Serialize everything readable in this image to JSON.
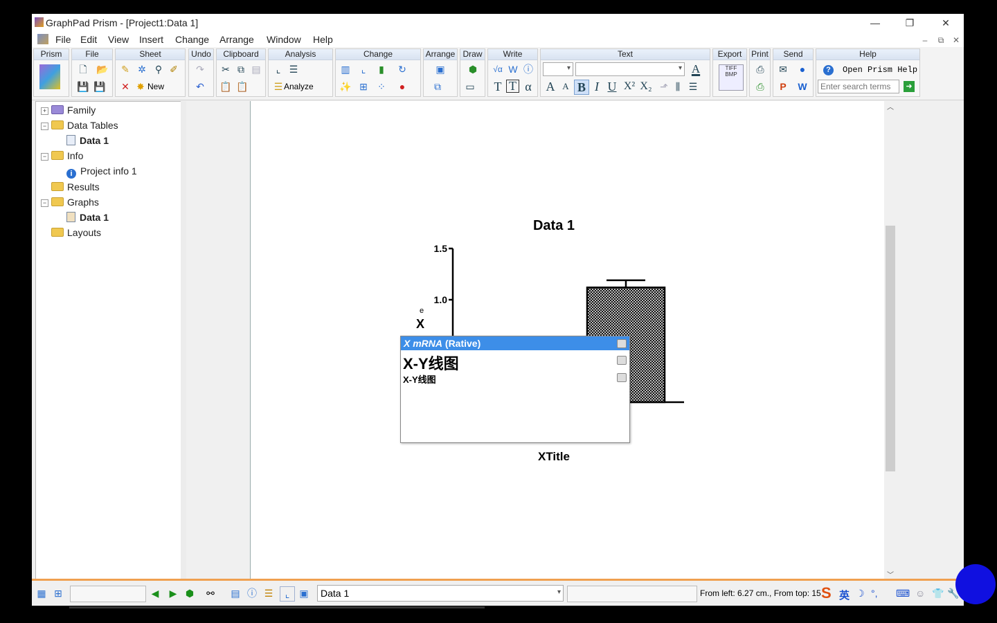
{
  "window": {
    "title": "GraphPad Prism - [Project1:Data 1]",
    "controls": {
      "minimize": "—",
      "restore": "❐",
      "close": "✕"
    },
    "mdi_controls": {
      "minimize": "–",
      "restore": "⧉",
      "close": "✕"
    }
  },
  "menu": [
    "File",
    "Edit",
    "View",
    "Insert",
    "Change",
    "Arrange",
    "Window",
    "Help"
  ],
  "toolbar": {
    "groups": [
      "Prism",
      "File",
      "Sheet",
      "Undo",
      "Clipboard",
      "Analysis",
      "Change",
      "Arrange",
      "Draw",
      "Write",
      "Text",
      "Export",
      "Print",
      "Send",
      "Help"
    ],
    "new_label": "New",
    "analyze_label": "Analyze",
    "help_label": "Open Prism Help",
    "search_placeholder": "Enter search terms",
    "text_glyphs": {
      "t1": "T",
      "t2": "T",
      "alpha": "α",
      "a_up": "A",
      "a_down": "A",
      "bold": "B",
      "italic": "I",
      "underline": "U",
      "sup": "X²",
      "sub": "X₂"
    },
    "export_label": "TIFF BMP"
  },
  "tree": {
    "family": "Family",
    "data_tables": "Data Tables",
    "data1_table": "Data 1",
    "info": "Info",
    "project_info": "Project info 1",
    "results": "Results",
    "graphs": "Graphs",
    "data1_graph": "Data 1",
    "layouts": "Layouts"
  },
  "chart_data": {
    "type": "bar",
    "title": "Data 1",
    "xlabel": "XTitle",
    "ylabel_fragments": [
      "X",
      "e"
    ],
    "yticks": [
      "1.5",
      "1.0"
    ],
    "ylim": [
      0,
      1.5
    ],
    "bar_value": 1.12,
    "error_upper": 1.19,
    "fill_pattern": "crosshatch"
  },
  "autocomplete": {
    "items": [
      {
        "italic": "X mRNA",
        "rest": " (Rative)"
      },
      {
        "text": "X-Y线图"
      },
      {
        "text": "X-Y线图"
      }
    ]
  },
  "statusbar": {
    "sheet_value": "Data 1",
    "position_text": "From left: 6.27 cm., From top: 15",
    "ime_glyphs": [
      "S",
      "英",
      "☽",
      "°,",
      "⌨",
      "☺",
      "👕",
      "🔧"
    ]
  },
  "colors": {
    "selection": "#3d8ee8",
    "accent_bar": "#f0a050"
  }
}
